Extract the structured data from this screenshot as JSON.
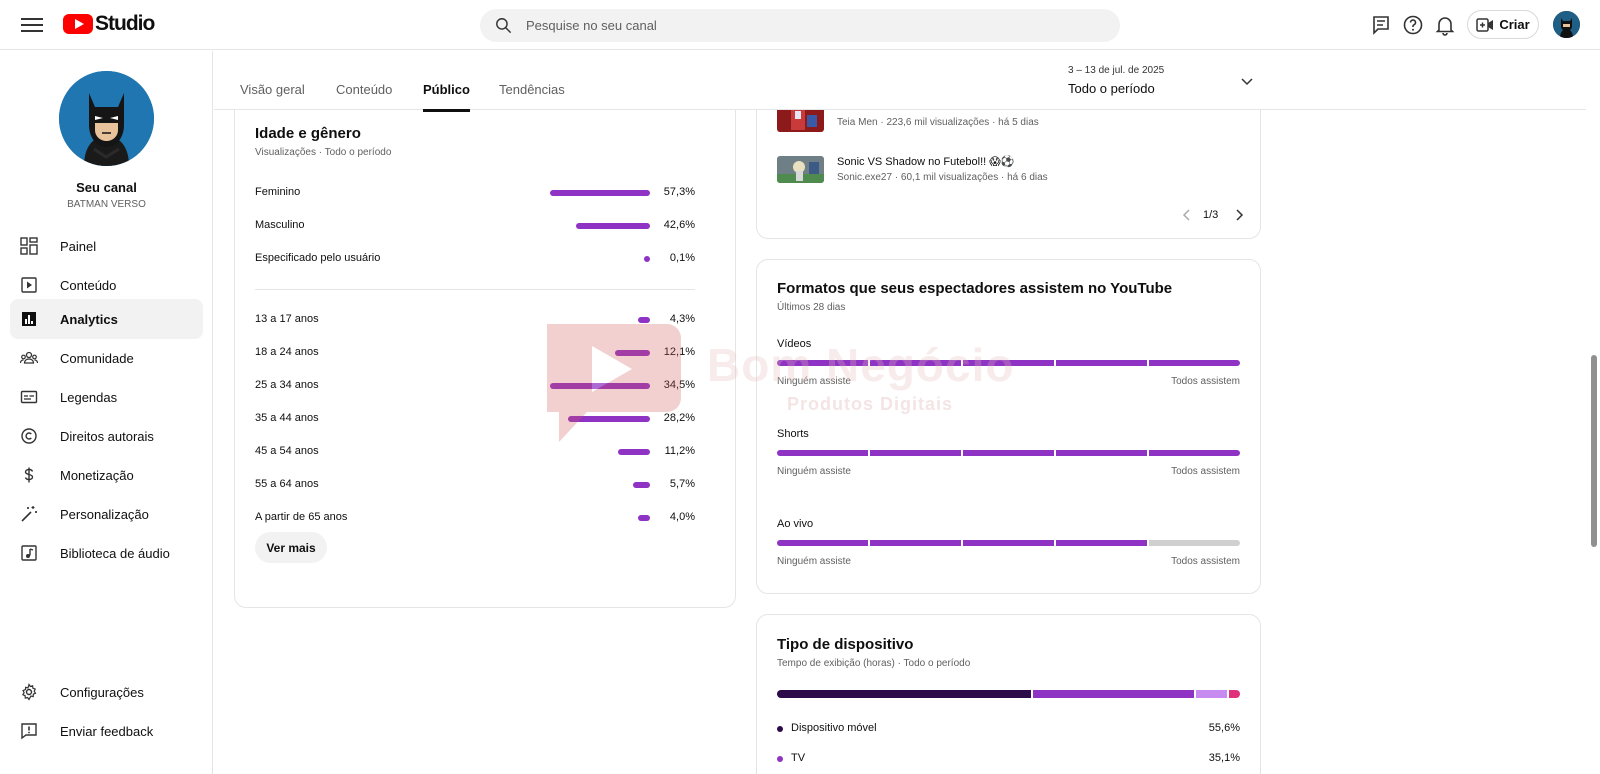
{
  "app": {
    "logo_text": "Studio"
  },
  "search": {
    "placeholder": "Pesquise no seu canal"
  },
  "topbar": {
    "create_label": "Criar"
  },
  "channel": {
    "name": "Seu canal",
    "handle": "BATMAN VERSO"
  },
  "sidebar": {
    "items": [
      {
        "label": "Painel",
        "icon": "dashboard-icon"
      },
      {
        "label": "Conteúdo",
        "icon": "content-icon"
      },
      {
        "label": "Analytics",
        "icon": "analytics-icon",
        "active": true
      },
      {
        "label": "Comunidade",
        "icon": "community-icon"
      },
      {
        "label": "Legendas",
        "icon": "subtitles-icon"
      },
      {
        "label": "Direitos autorais",
        "icon": "copyright-icon"
      },
      {
        "label": "Monetização",
        "icon": "dollar-icon"
      },
      {
        "label": "Personalização",
        "icon": "magic-wand-icon"
      },
      {
        "label": "Biblioteca de áudio",
        "icon": "audio-library-icon"
      }
    ],
    "bottom_items": [
      {
        "label": "Configurações",
        "icon": "gear-icon"
      },
      {
        "label": "Enviar feedback",
        "icon": "feedback-icon"
      }
    ]
  },
  "tabs": [
    {
      "label": "Visão geral"
    },
    {
      "label": "Conteúdo"
    },
    {
      "label": "Público",
      "active": true
    },
    {
      "label": "Tendências"
    }
  ],
  "date": {
    "range": "3 – 13 de jul. de 2025",
    "period": "Todo o período"
  },
  "age_gender": {
    "title": "Idade e gênero",
    "subtitle": "Visualizações · Todo o período",
    "gender": [
      {
        "label": "Feminino",
        "pct_text": "57,3%",
        "value": 57.3
      },
      {
        "label": "Masculino",
        "pct_text": "42,6%",
        "value": 42.6
      },
      {
        "label": "Especificado pelo usuário",
        "pct_text": "0,1%",
        "value": 0.1
      }
    ],
    "age": [
      {
        "label": "13 a 17 anos",
        "pct_text": "4,3%",
        "value": 4.3
      },
      {
        "label": "18 a 24 anos",
        "pct_text": "12,1%",
        "value": 12.1
      },
      {
        "label": "25 a 34 anos",
        "pct_text": "34,5%",
        "value": 34.5
      },
      {
        "label": "35 a 44 anos",
        "pct_text": "28,2%",
        "value": 28.2
      },
      {
        "label": "45 a 54 anos",
        "pct_text": "11,2%",
        "value": 11.2
      },
      {
        "label": "55 a 64 anos",
        "pct_text": "5,7%",
        "value": 5.7
      },
      {
        "label": "A partir de 65 anos",
        "pct_text": "4,0%",
        "value": 4.0
      }
    ],
    "more_label": "Ver mais"
  },
  "videos": {
    "items": [
      {
        "meta": "Teia Men · 223,6 mil visualizações · há 5 dias"
      },
      {
        "title": "Sonic VS Shadow no Futebol!! 😱⚽",
        "meta": "Sonic.exe27 · 60,1 mil visualizações · há 6 dias"
      }
    ],
    "pager": "1/3"
  },
  "formats": {
    "title": "Formatos que seus espectadores assistem no YouTube",
    "subtitle": "Últimos 28 dias",
    "scale_left": "Ninguém assiste",
    "scale_right": "Todos assistem",
    "rows": [
      {
        "label": "Vídeos",
        "filled_segments": 5,
        "total_segments": 5
      },
      {
        "label": "Shorts",
        "filled_segments": 5,
        "total_segments": 5
      },
      {
        "label": "Ao vivo",
        "filled_segments": 4,
        "total_segments": 5
      }
    ]
  },
  "devices": {
    "title": "Tipo de dispositivo",
    "subtitle": "Tempo de exibição (horas) · Todo o período",
    "items": [
      {
        "label": "Dispositivo móvel",
        "pct_text": "55,6%",
        "value": 55.6,
        "color": "#2d0a4a"
      },
      {
        "label": "TV",
        "pct_text": "35,1%",
        "value": 35.1,
        "color": "#8e33c3"
      },
      {
        "value": 6.8,
        "color": "#c78af0"
      },
      {
        "value": 2.5,
        "color": "#e0327a"
      }
    ]
  },
  "watermark": {
    "brand": "Bom Negócio",
    "tagline": "Produtos Digitais"
  },
  "colors": {
    "accent": "#8e33c3",
    "brand_red": "#ff0000"
  }
}
